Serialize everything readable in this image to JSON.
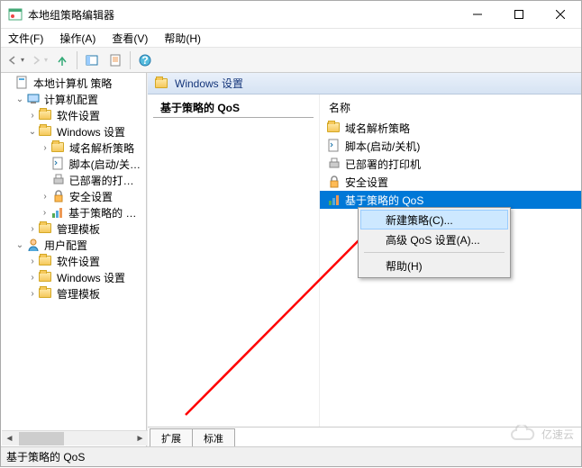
{
  "window": {
    "title": "本地组策略编辑器"
  },
  "menubar": {
    "file": "文件(F)",
    "action": "操作(A)",
    "view": "查看(V)",
    "help": "帮助(H)"
  },
  "tree": {
    "root": "本地计算机 策略",
    "computer_config": "计算机配置",
    "software_settings": "软件设置",
    "windows_settings": "Windows 设置",
    "dns_policy": "域名解析策略",
    "scripts": "脚本(启动/关机)",
    "deployed_printers": "已部署的打印机",
    "security_settings": "安全设置",
    "qos_policy": "基于策略的 QoS",
    "admin_templates": "管理模板",
    "user_config": "用户配置",
    "us_software": "软件设置",
    "us_windows": "Windows 设置",
    "us_admin": "管理模板"
  },
  "content": {
    "header": "Windows 设置",
    "section": "基于策略的 QoS",
    "col_name": "名称",
    "items": {
      "dns": "域名解析策略",
      "scripts": "脚本(启动/关机)",
      "printers": "已部署的打印机",
      "security": "安全设置",
      "qos": "基于策略的 QoS"
    }
  },
  "context_menu": {
    "new_policy": "新建策略(C)...",
    "adv_qos": "高级 QoS 设置(A)...",
    "help": "帮助(H)"
  },
  "tabs": {
    "extended": "扩展",
    "standard": "标准"
  },
  "status": "基于策略的 QoS",
  "watermark": "亿速云"
}
